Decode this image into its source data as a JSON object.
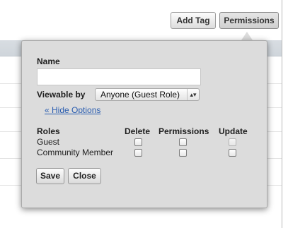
{
  "toolbar": {
    "add_tag_label": "Add Tag",
    "permissions_label": "Permissions"
  },
  "popover": {
    "name_label": "Name",
    "name_value": "",
    "viewable_by_label": "Viewable by",
    "viewable_by_value": "Anyone (Guest Role)",
    "hide_options_link": "« Hide Options",
    "headers": {
      "roles": "Roles",
      "delete": "Delete",
      "permissions": "Permissions",
      "update": "Update"
    },
    "rows": [
      {
        "role": "Guest",
        "delete": false,
        "permissions": false,
        "update": false,
        "update_disabled": true
      },
      {
        "role": "Community Member",
        "delete": false,
        "permissions": false,
        "update": false,
        "update_disabled": false
      }
    ],
    "save_label": "Save",
    "close_label": "Close"
  }
}
